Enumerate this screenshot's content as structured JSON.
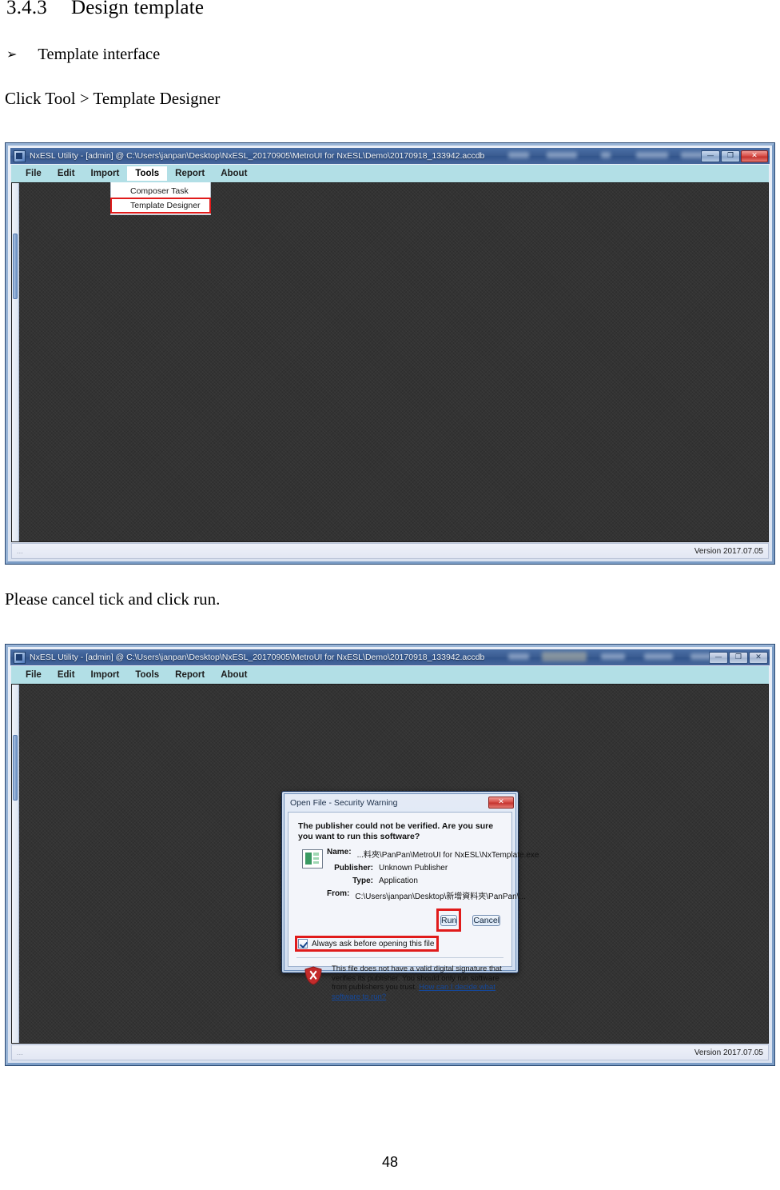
{
  "document": {
    "heading_number": "3.4.3",
    "heading_text": "Design template",
    "bullet_arrow": "➢",
    "bullet_text": "Template interface",
    "paragraph_1": "Click Tool > Template Designer",
    "paragraph_2": "Please cancel tick and click run.",
    "page_number": "48"
  },
  "app_window": {
    "title": "NxESL Utility - [admin] @ C:\\Users\\janpan\\Desktop\\NxESL_20170905\\MetroUI for NxESL\\Demo\\20170918_133942.accdb",
    "title_icon": "app-window-icon",
    "window_controls": {
      "minimize": "—",
      "maximize": "❐",
      "close": "✕"
    },
    "menu": [
      {
        "label": "File",
        "open": false
      },
      {
        "label": "Edit",
        "open": false
      },
      {
        "label": "Import",
        "open": false
      },
      {
        "label": "Tools",
        "open": true
      },
      {
        "label": "Report",
        "open": false
      },
      {
        "label": "About",
        "open": false
      }
    ],
    "tools_dropdown": [
      {
        "label": "Composer Task",
        "highlighted": false
      },
      {
        "label": "Template Designer",
        "highlighted": true
      }
    ],
    "status_left": "...",
    "status_version": "Version 2017.07.05",
    "content_background_color": "#333333",
    "menubar_color": "#b2dfe6",
    "highlight_color": "#e01b1b"
  },
  "security_dialog": {
    "title": "Open File - Security Warning",
    "close_label": "✕",
    "question": "The publisher could not be verified.  Are you sure you want to run this software?",
    "app_icon": "application-file-icon",
    "fields": [
      {
        "label": "Name:",
        "value": "...料夾\\PanPan\\MetroUI for NxESL\\NxTemplate.exe"
      },
      {
        "label": "Publisher:",
        "value": "Unknown Publisher"
      },
      {
        "label": "Type:",
        "value": "Application"
      },
      {
        "label": "From:",
        "value": "C:\\Users\\janpan\\Desktop\\新增資料夾\\PanPan\\..."
      }
    ],
    "buttons": [
      {
        "label": "Run",
        "highlighted": true
      },
      {
        "label": "Cancel",
        "highlighted": false
      }
    ],
    "checkbox": {
      "label": "Always ask before opening this file",
      "checked": true,
      "highlighted": true
    },
    "warning_icon": "red-shield-warning-icon",
    "warning_text": "This file does not have a valid digital signature that verifies its publisher.  You should only run software from publishers you trust.",
    "warning_link": "How can I decide what software to run?"
  }
}
